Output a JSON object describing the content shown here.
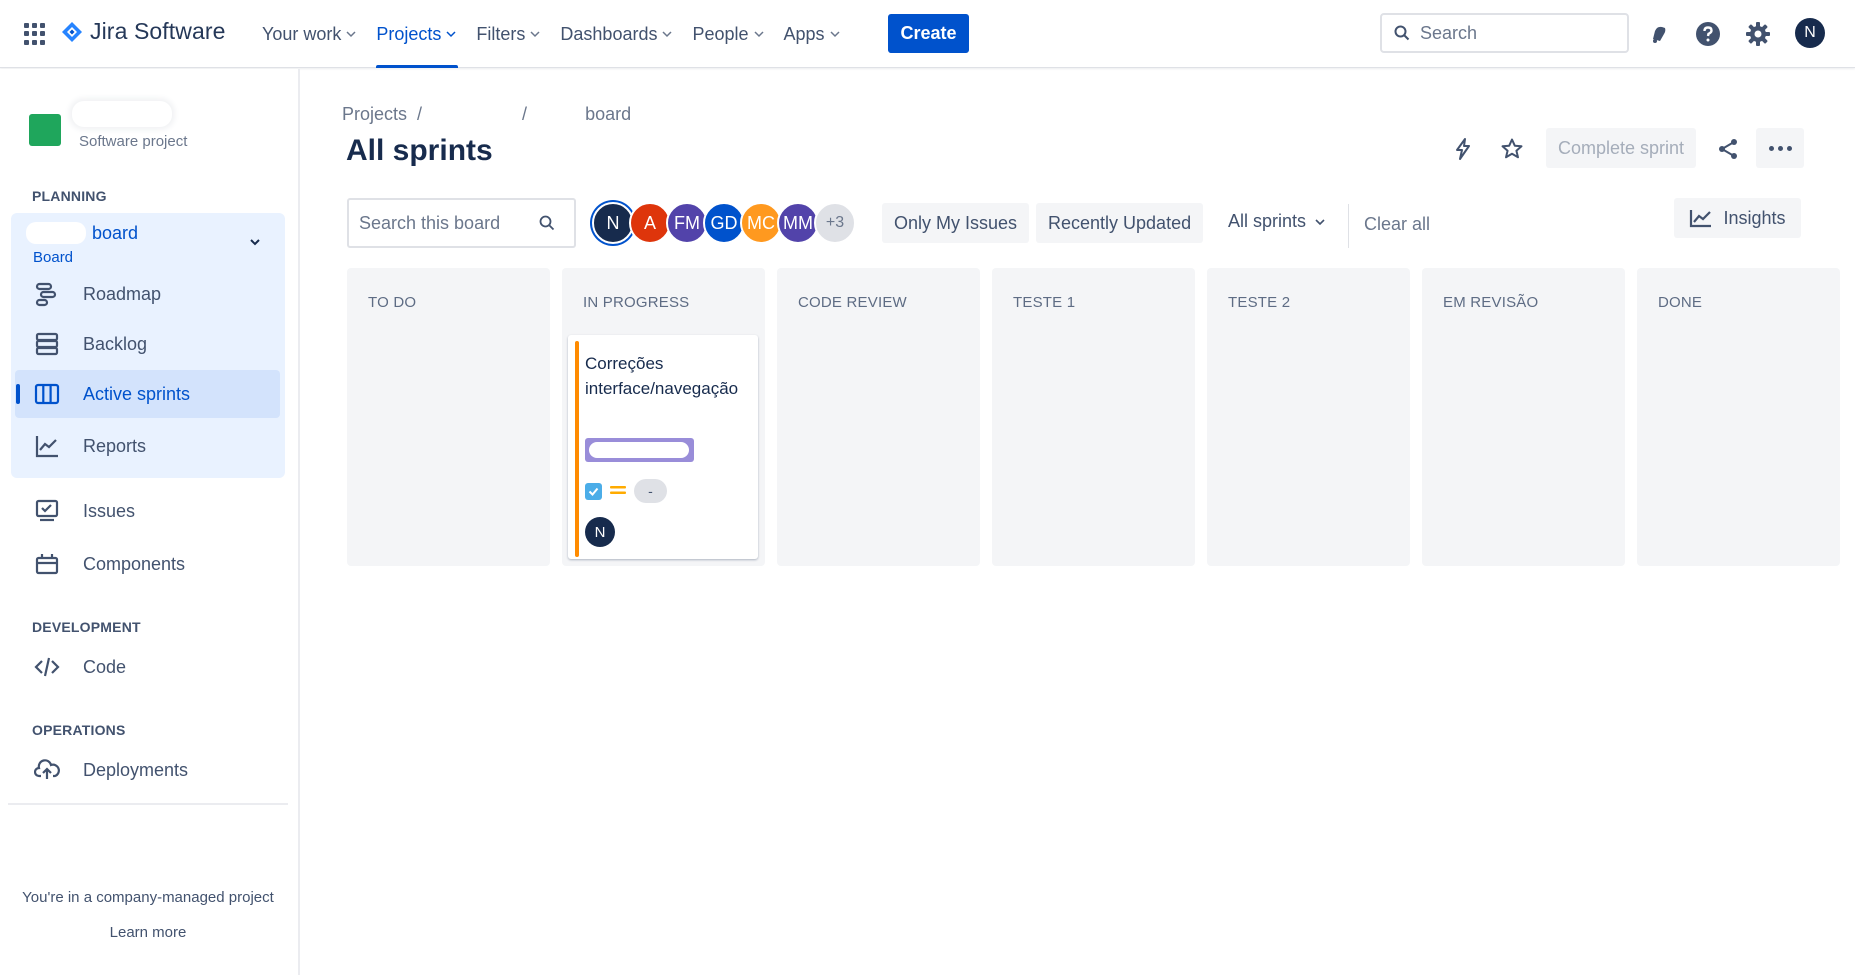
{
  "topnav": {
    "product_name": "Jira Software",
    "items": [
      {
        "label": "Your work",
        "active": false
      },
      {
        "label": "Projects",
        "active": true
      },
      {
        "label": "Filters",
        "active": false
      },
      {
        "label": "Dashboards",
        "active": false
      },
      {
        "label": "People",
        "active": false
      },
      {
        "label": "Apps",
        "active": false
      }
    ],
    "create_label": "Create",
    "search_placeholder": "Search",
    "user_initial": "N"
  },
  "sidebar": {
    "project_type": "Software project",
    "planning_label": "PLANNING",
    "board_name": "board",
    "board_sub": "Board",
    "planning_items": [
      {
        "label": "Roadmap",
        "icon": "roadmap-icon"
      },
      {
        "label": "Backlog",
        "icon": "backlog-icon"
      },
      {
        "label": "Active sprints",
        "icon": "board-icon",
        "selected": true
      },
      {
        "label": "Reports",
        "icon": "reports-icon"
      }
    ],
    "other_items": [
      {
        "label": "Issues",
        "icon": "issues-icon"
      },
      {
        "label": "Components",
        "icon": "components-icon"
      }
    ],
    "development_label": "DEVELOPMENT",
    "code_label": "Code",
    "operations_label": "OPERATIONS",
    "deployments_label": "Deployments",
    "footer_text": "You're in a company-managed project",
    "learn_more": "Learn more"
  },
  "main": {
    "breadcrumb": {
      "projects": "Projects",
      "separator": "/",
      "board": "board"
    },
    "title": "All sprints",
    "complete_sprint_label": "Complete sprint",
    "board_search_placeholder": "Search this board",
    "avatars": [
      {
        "initials": "N",
        "color": "#172b4d"
      },
      {
        "initials": "A",
        "color": "#de350b"
      },
      {
        "initials": "FM",
        "color": "#5243aa"
      },
      {
        "initials": "GD",
        "color": "#0052cc"
      },
      {
        "initials": "MC",
        "color": "#ff991f"
      },
      {
        "initials": "MM",
        "color": "#5243aa"
      },
      {
        "initials": "+3",
        "color": "#dfe1e6"
      }
    ],
    "filters": {
      "only_my_issues": "Only My Issues",
      "recently_updated": "Recently Updated"
    },
    "sprint_select": "All sprints",
    "clear_all": "Clear all",
    "insights_label": "Insights"
  },
  "columns": [
    "TO DO",
    "IN PROGRESS",
    "CODE REVIEW",
    "TESTE 1",
    "TESTE 2",
    "EM REVISÃO",
    "DONE"
  ],
  "card": {
    "summary": "Correções interface/navegação",
    "estimate": "-",
    "assignee_initial": "N"
  },
  "colors": {
    "accent": "#0052cc",
    "card_stripe": "#ff8b00",
    "epic": "#998dd9",
    "project_icon": "#1fa65c"
  }
}
